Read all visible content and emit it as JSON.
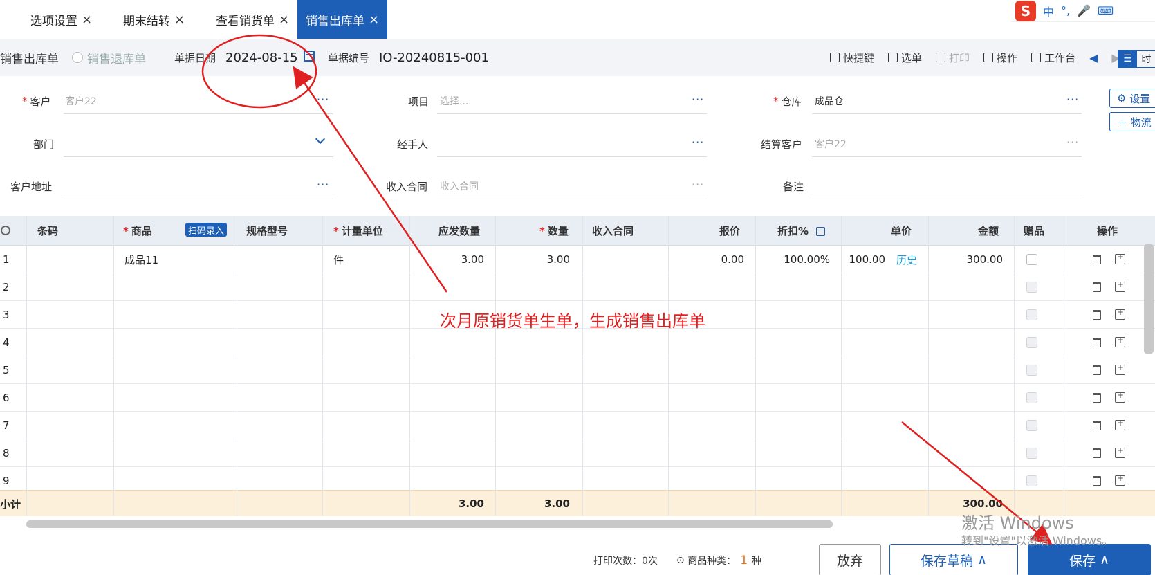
{
  "tabs": [
    {
      "label": "选项设置",
      "close": "×"
    },
    {
      "label": "期末结转",
      "close": "×"
    },
    {
      "label": "查看销货单",
      "close": "×"
    },
    {
      "label": "销售出库单",
      "close": "×",
      "active": true
    }
  ],
  "ime": {
    "logo": "S",
    "mode": "中",
    "punct": "°,"
  },
  "header": {
    "type_options": [
      "销售出库单",
      "销售退库单"
    ],
    "date_label": "单据日期",
    "date_value": "2024-08-15",
    "code_label": "单据编号",
    "code_value": "IO-20240815-001",
    "toolbar": [
      "快捷键",
      "选单",
      "打印",
      "操作",
      "工作台"
    ],
    "view_toggle": [
      "☰",
      "时"
    ]
  },
  "form": {
    "customer_label": "客户",
    "customer_value": "客户22",
    "project_label": "项目",
    "project_placeholder": "选择...",
    "warehouse_label": "仓库",
    "warehouse_value": "成品仓",
    "dept_label": "部门",
    "handler_label": "经手人",
    "settle_label": "结算客户",
    "settle_value": "客户22",
    "address_label": "客户地址",
    "contract_label": "收入合同",
    "contract_placeholder": "收入合同",
    "remark_label": "备注",
    "dots": "···",
    "settings_btn": "设置",
    "logistics_btn": "物流"
  },
  "grid": {
    "headers": {
      "barcode": "条码",
      "product": "商品",
      "scan": "扫码录入",
      "spec": "规格型号",
      "unit": "计量单位",
      "due_qty": "应发数量",
      "qty": "数量",
      "contract": "收入合同",
      "quote": "报价",
      "discount": "折扣%",
      "price": "单价",
      "amount": "金额",
      "gift": "赠品",
      "ops": "操作"
    },
    "rows": [
      {
        "no": "1",
        "product": "成品11",
        "unit": "件",
        "due_qty": "3.00",
        "qty": "3.00",
        "quote": "0.00",
        "discount": "100.00%",
        "price": "100.00",
        "history": "历史",
        "amount": "300.00"
      },
      {
        "no": "2"
      },
      {
        "no": "3"
      },
      {
        "no": "4"
      },
      {
        "no": "5"
      },
      {
        "no": "6"
      },
      {
        "no": "7"
      },
      {
        "no": "8"
      },
      {
        "no": "9"
      }
    ],
    "subtotal": {
      "label": "小计",
      "due_qty": "3.00",
      "qty": "3.00",
      "amount": "300.00"
    }
  },
  "footer": {
    "print_count": "打印次数：0次",
    "kind_label": "商品种类：",
    "kind_count": "1",
    "kind_unit": "种",
    "discard": "放弃",
    "save_draft": "保存草稿",
    "save": "保存"
  },
  "annotation": "次月原销货单生单，生成销售出库单",
  "windows": {
    "line1": "激活 Windows",
    "line2": "转到\"设置\"以激活 Windows。"
  },
  "colors": {
    "primary": "#1d5fb6",
    "annotation": "#e02020",
    "subtotal_bg": "#fdf0da"
  }
}
